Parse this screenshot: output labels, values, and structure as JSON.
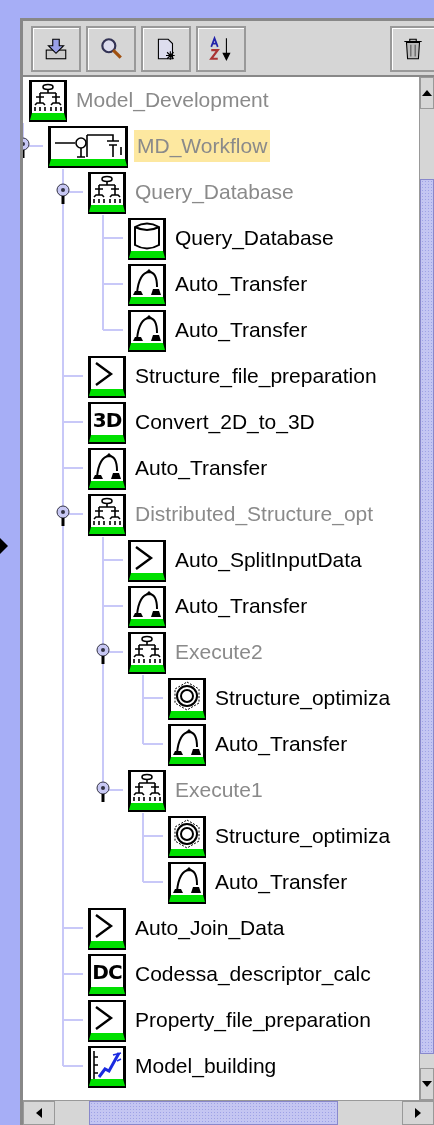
{
  "tree": [
    {
      "label": "Model_Development",
      "kind": "group",
      "selected": false,
      "children": [
        {
          "label": "MD_Workflow",
          "kind": "workflow",
          "selected": true,
          "expanded": true,
          "children": [
            {
              "label": "Query_Database",
              "kind": "group",
              "selected": false,
              "expanded": true,
              "children": [
                {
                  "label": "Query_Database",
                  "kind": "database",
                  "selected": false
                },
                {
                  "label": "Auto_Transfer",
                  "kind": "transfer",
                  "selected": false
                },
                {
                  "label": "Auto_Transfer",
                  "kind": "transfer",
                  "selected": false
                }
              ]
            },
            {
              "label": "Structure_file_preparation",
              "kind": "script",
              "selected": false
            },
            {
              "label": "Convert_2D_to_3D",
              "kind": "lettered",
              "icon_text": "3D",
              "selected": false
            },
            {
              "label": "Auto_Transfer",
              "kind": "transfer",
              "selected": false
            },
            {
              "label": "Distributed_Structure_opt",
              "kind": "group",
              "selected": false,
              "expanded": true,
              "children": [
                {
                  "label": "Auto_SplitInputData",
                  "kind": "script",
                  "selected": false
                },
                {
                  "label": "Auto_Transfer",
                  "kind": "transfer",
                  "selected": false
                },
                {
                  "label": "Execute2",
                  "kind": "group",
                  "selected": false,
                  "expanded": true,
                  "children": [
                    {
                      "label": "Structure_optimiza",
                      "kind": "optimizer",
                      "selected": false
                    },
                    {
                      "label": "Auto_Transfer",
                      "kind": "transfer",
                      "selected": false
                    }
                  ]
                },
                {
                  "label": "Execute1",
                  "kind": "group",
                  "selected": false,
                  "expanded": true,
                  "children": [
                    {
                      "label": "Structure_optimiza",
                      "kind": "optimizer",
                      "selected": false
                    },
                    {
                      "label": "Auto_Transfer",
                      "kind": "transfer",
                      "selected": false
                    }
                  ]
                }
              ]
            },
            {
              "label": "Auto_Join_Data",
              "kind": "script",
              "selected": false
            },
            {
              "label": "Codessa_descriptor_calc",
              "kind": "lettered",
              "icon_text": "DC",
              "selected": false
            },
            {
              "label": "Property_file_preparation",
              "kind": "script",
              "selected": false
            },
            {
              "label": "Model_building",
              "kind": "model",
              "selected": false
            }
          ]
        }
      ]
    }
  ]
}
